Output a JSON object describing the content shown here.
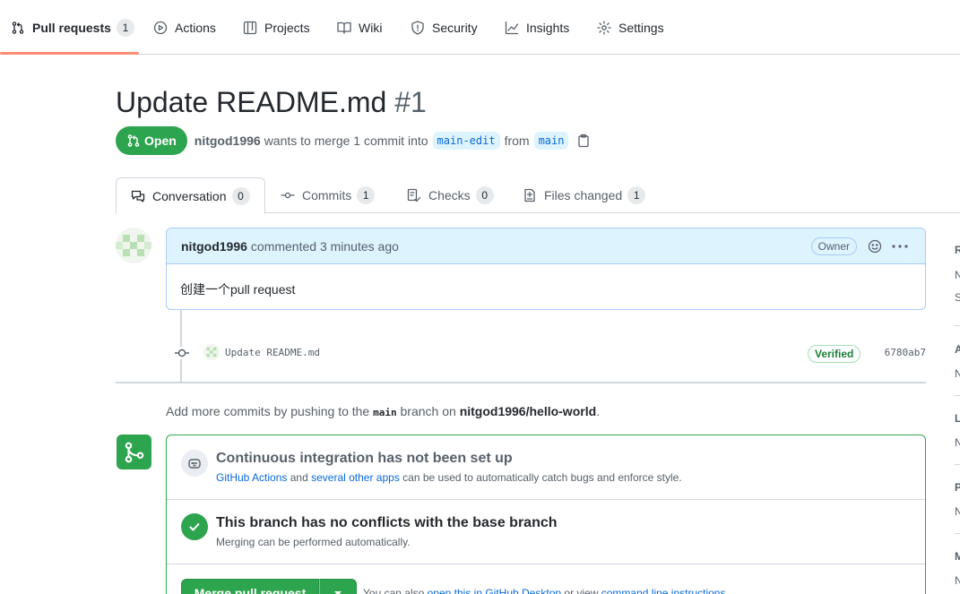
{
  "nav": {
    "items": [
      {
        "label": "Pull requests",
        "count": "1",
        "icon": "git-pull-request-icon"
      },
      {
        "label": "Actions",
        "icon": "play-icon"
      },
      {
        "label": "Projects",
        "icon": "table-icon"
      },
      {
        "label": "Wiki",
        "icon": "book-icon"
      },
      {
        "label": "Security",
        "icon": "shield-icon"
      },
      {
        "label": "Insights",
        "icon": "graph-icon"
      },
      {
        "label": "Settings",
        "icon": "gear-icon"
      }
    ]
  },
  "pr": {
    "title": "Update README.md",
    "number": "#1",
    "state": "Open",
    "author": "nitgod1996",
    "merge_text": "wants to merge 1 commit into",
    "base_branch": "main-edit",
    "from_text": "from",
    "head_branch": "main"
  },
  "tabs": [
    {
      "label": "Conversation",
      "count": "0"
    },
    {
      "label": "Commits",
      "count": "1"
    },
    {
      "label": "Checks",
      "count": "0"
    },
    {
      "label": "Files changed",
      "count": "1"
    }
  ],
  "comment": {
    "author": "nitgod1996",
    "meta": "commented 3 minutes ago",
    "role": "Owner",
    "body": "创建一个pull request"
  },
  "commit": {
    "message": "Update README.md",
    "verified": "Verified",
    "sha": "6780ab7"
  },
  "push_hint": {
    "prefix": "Add more commits by pushing to the",
    "branch": "main",
    "middle": "branch on",
    "repo": "nitgod1996/hello-world",
    "suffix": "."
  },
  "merge": {
    "ci_title": "Continuous integration has not been set up",
    "ci_link1": "GitHub Actions",
    "ci_and": "and",
    "ci_link2": "several other apps",
    "ci_rest": "can be used to automatically catch bugs and enforce style.",
    "conflict_title": "This branch has no conflicts with the base branch",
    "conflict_sub": "Merging can be performed automatically.",
    "button": "Merge pull request",
    "alt_prefix": "You can also",
    "alt_link1": "open this in GitHub Desktop",
    "alt_mid": "or view",
    "alt_link2": "command line instructions",
    "alt_suffix": "."
  },
  "sidebar": {
    "letters": [
      {
        "head": "R",
        "vals": [
          "N",
          "S"
        ]
      },
      {
        "head": "A",
        "vals": [
          "N"
        ]
      },
      {
        "head": "L",
        "vals": [
          "N"
        ]
      },
      {
        "head": "P",
        "vals": [
          "N"
        ]
      },
      {
        "head": "M",
        "vals": [
          "N"
        ]
      }
    ]
  },
  "colors": {
    "accent_green": "#2da44e",
    "link_blue": "#0969da",
    "nav_underline": "#fd8c73"
  }
}
